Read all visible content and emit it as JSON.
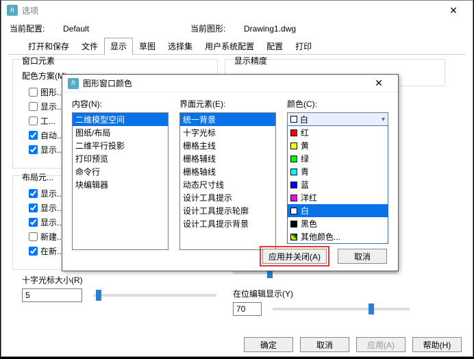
{
  "window": {
    "title": "选项"
  },
  "profile": {
    "current_label": "当前配置:",
    "current_value": "Default",
    "drawing_label": "当前图形:",
    "drawing_value": "Drawing1.dwg"
  },
  "tabs": [
    "打开和保存",
    "文件",
    "显示",
    "草图",
    "选择集",
    "用户系统配置",
    "配置",
    "打印"
  ],
  "active_tab": "显示",
  "left": {
    "group": "窗口元素",
    "scheme_label": "配色方案(M):",
    "chk1": "图形...",
    "chk2": "显示...",
    "chk3": "工...",
    "chk4": "自动...",
    "chk5": "显示...",
    "group2": "布局元...",
    "chk6": "显示...",
    "chk7": "显示...",
    "chk8": "显示...",
    "chk9": "新建...",
    "chk10": "在新...",
    "cross_label": "十字光标大小(R)",
    "cross_value": "5"
  },
  "right": {
    "group": "显示精度",
    "edit_label": "在位编辑显示(Y)",
    "edit_value": "70"
  },
  "main_buttons": {
    "ok": "确定",
    "cancel": "取消",
    "apply": "应用(A)",
    "help": "帮助(H)"
  },
  "color_dialog": {
    "title": "图形窗口颜色",
    "context_label": "内容(N):",
    "context_items": [
      "二维模型空间",
      "图纸/布局",
      "二维平行投影",
      "打印预览",
      "命令行",
      "块编辑器"
    ],
    "element_label": "界面元素(E):",
    "element_items": [
      "统一背景",
      "十字光标",
      "栅格主线",
      "栅格辅线",
      "栅格轴线",
      "动态尺寸线",
      "设计工具提示",
      "设计工具提示轮廓",
      "设计工具提示背景"
    ],
    "color_label": "颜色(C):",
    "color_current": "白",
    "color_options": [
      {
        "name": "红",
        "hex": "#ff0000"
      },
      {
        "name": "黄",
        "hex": "#ffff00"
      },
      {
        "name": "绿",
        "hex": "#00ff00"
      },
      {
        "name": "青",
        "hex": "#00ffff"
      },
      {
        "name": "蓝",
        "hex": "#0000ff"
      },
      {
        "name": "洋红",
        "hex": "#ff00ff"
      },
      {
        "name": "白",
        "hex": "#ffffff"
      },
      {
        "name": "黑色",
        "hex": "#000000"
      },
      {
        "name": "其他颜色...",
        "hex": "multi"
      }
    ],
    "apply_close": "应用并关闭(A)",
    "cancel": "取消"
  }
}
